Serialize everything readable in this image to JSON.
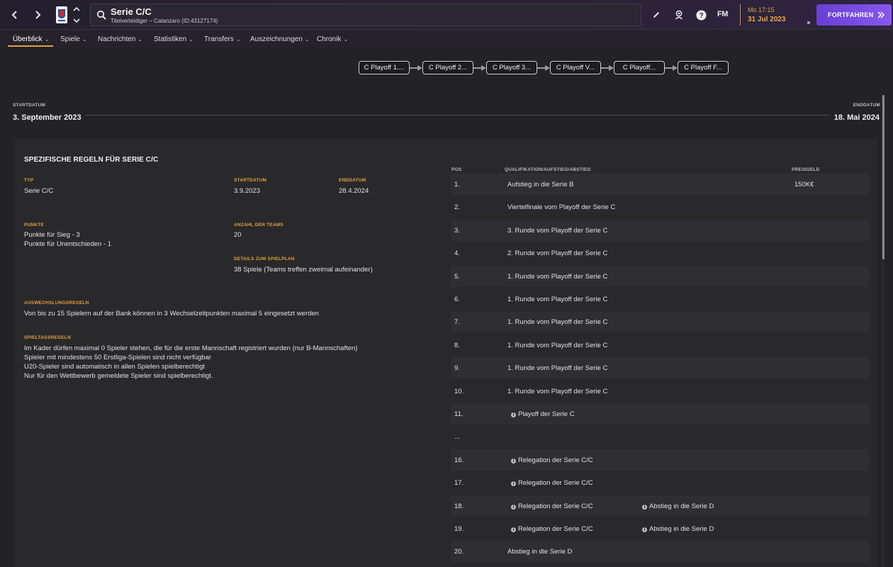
{
  "header": {
    "title": "Serie C/C",
    "subtitle": "Titelverteidiger – Catanzaro (ID:43127174)",
    "time": "Mo 17:15",
    "date": "31 Jul 2023",
    "continue_label": "FORTFAHREN",
    "fm_label": "FM",
    "accent_color": "#e3a13c",
    "button_color": "#7b4be4"
  },
  "tabs": [
    {
      "label": "Überblick"
    },
    {
      "label": "Spiele"
    },
    {
      "label": "Nachrichten"
    },
    {
      "label": "Statistiken"
    },
    {
      "label": "Transfers"
    },
    {
      "label": "Auszeichnungen"
    },
    {
      "label": "Chronik"
    }
  ],
  "stages": [
    {
      "label": "C Playoff 1...."
    },
    {
      "label": "C Playoff 2..."
    },
    {
      "label": "C Playoff 3..."
    },
    {
      "label": "C Playoff V..."
    },
    {
      "label": "C Playoff..."
    },
    {
      "label": "C Playoff F..."
    }
  ],
  "timeline": {
    "start_label": "STARTDATUM",
    "start_value": "3. September 2023",
    "end_label": "ENDDATUM",
    "end_value": "18. Mai 2024"
  },
  "rules": {
    "title": "SPEZIFISCHE REGELN FÜR SERIE C/C",
    "typ_label": "TYP",
    "typ_value": "Serie C/C",
    "start_label": "STARTDATUM",
    "start_value": "3.9.2023",
    "end_label": "ENDDATUM",
    "end_value": "28.4.2024",
    "punkte_label": "PUNKTE",
    "punkte_lines": [
      "Punkte für Sieg - 3",
      "Punkte für Unentschieden - 1"
    ],
    "teams_label": "ANZAHL DER TEAMS",
    "teams_value": "20",
    "plan_label": "DETAILS ZUM SPIELPLAN",
    "plan_value": "38 Spiele (Teams treffen zweimal aufeinander)",
    "subs_label": "AUSWECHSLUNGSREGELN",
    "subs_value": "Von bis zu 15 Spielern auf der Bank können in 3 Wechselzeitpunkten maximal 5 eingesetzt werden",
    "matchday_label": "SPIELTAGSREGELN",
    "matchday_lines": [
      "Im Kader dürfen maximal 0 Spieler stehen, die für die erste Mannschaft registriert wurden  (nur B-Mannschaften)",
      "Spieler mit mindestens 50 Erstliga-Spielen sind nicht verfügbar",
      "U20-Spieler sind automatisch in allen Spielen spielberechtigt",
      "Nur für den Wettbewerb gemeldete Spieler sind spielberechtigt."
    ]
  },
  "table": {
    "col_pos": "POS",
    "col_qual": "QUALIFIKATION/AUFSTIEG/ABSTIEG",
    "col_prize": "PREISGELD",
    "rows": [
      {
        "pos": "1.",
        "q": "Aufstieg in die Serie B",
        "info": false,
        "q2": "",
        "prize": "150K€"
      },
      {
        "pos": "2.",
        "q": "Viertelfinale vom Playoff der Serie C",
        "info": false,
        "q2": "",
        "prize": ""
      },
      {
        "pos": "3.",
        "q": "3. Runde vom Playoff der Serie C",
        "info": false,
        "q2": "",
        "prize": ""
      },
      {
        "pos": "4.",
        "q": "2. Runde vom Playoff der Serie C",
        "info": false,
        "q2": "",
        "prize": ""
      },
      {
        "pos": "5.",
        "q": "1. Runde vom Playoff der Serie C",
        "info": false,
        "q2": "",
        "prize": ""
      },
      {
        "pos": "6.",
        "q": "1. Runde vom Playoff der Serie C",
        "info": false,
        "q2": "",
        "prize": ""
      },
      {
        "pos": "7.",
        "q": "1. Runde vom Playoff der Serie C",
        "info": false,
        "q2": "",
        "prize": ""
      },
      {
        "pos": "8.",
        "q": "1. Runde vom Playoff der Serie C",
        "info": false,
        "q2": "",
        "prize": ""
      },
      {
        "pos": "9.",
        "q": "1. Runde vom Playoff der Serie C",
        "info": false,
        "q2": "",
        "prize": ""
      },
      {
        "pos": "10.",
        "q": "1. Runde vom Playoff der Serie C",
        "info": false,
        "q2": "",
        "prize": ""
      },
      {
        "pos": "11.",
        "q": "Playoff der Serie C",
        "info": true,
        "q2": "",
        "prize": ""
      },
      {
        "pos": "...",
        "q": "",
        "info": false,
        "q2": "",
        "prize": ""
      },
      {
        "pos": "16.",
        "q": "Relegation der Serie C/C",
        "info": true,
        "q2": "",
        "prize": ""
      },
      {
        "pos": "17.",
        "q": "Relegation der Serie C/C",
        "info": true,
        "q2": "",
        "prize": ""
      },
      {
        "pos": "18.",
        "q": "Relegation der Serie C/C",
        "info": true,
        "q2": "Abstieg in die Serie D",
        "prize": ""
      },
      {
        "pos": "19.",
        "q": "Relegation der Serie C/C",
        "info": true,
        "q2": "Abstieg in die Serie D",
        "prize": ""
      },
      {
        "pos": "20.",
        "q": "Abstieg in die Serie D",
        "info": false,
        "q2": "",
        "prize": ""
      }
    ]
  }
}
